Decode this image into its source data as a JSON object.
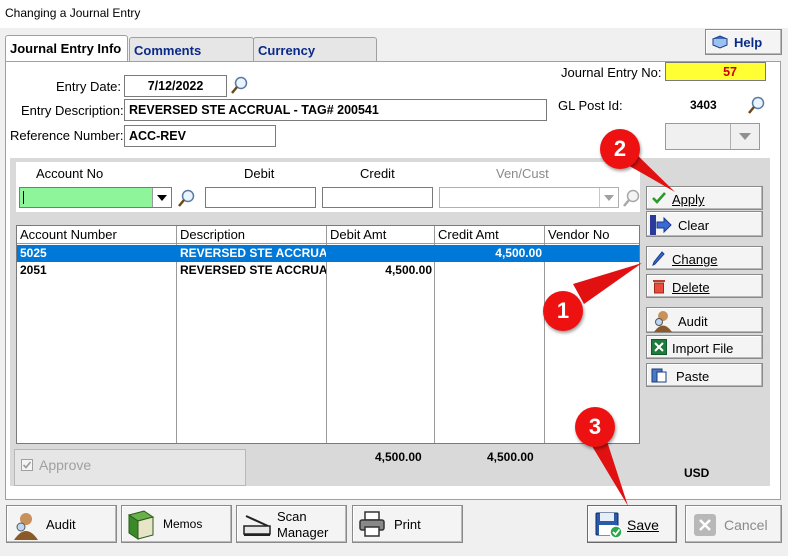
{
  "window": {
    "title": "Changing a Journal Entry"
  },
  "tabs": [
    {
      "label": "Journal Entry Info",
      "active": true
    },
    {
      "label": "Comments",
      "active": false
    },
    {
      "label": "Currency",
      "active": false
    }
  ],
  "help_label": "Help",
  "form": {
    "entry_date_label": "Entry Date:",
    "entry_date": "7/12/2022",
    "entry_description_label": "Entry Description:",
    "entry_description": "REVERSED STE ACCRUAL - TAG# 200541",
    "reference_number_label": "Reference Number:",
    "reference_number": "ACC-REV",
    "journal_entry_no_label": "Journal Entry No:",
    "journal_entry_no": "57",
    "gl_post_id_label": "GL Post Id:",
    "gl_post_id": "3403"
  },
  "entry_line": {
    "account_no_label": "Account No",
    "debit_label": "Debit",
    "credit_label": "Credit",
    "ven_cust_label": "Ven/Cust"
  },
  "grid": {
    "columns": [
      "Account Number",
      "Description",
      "Debit Amt",
      "Credit Amt",
      "Vendor No"
    ],
    "rows": [
      {
        "account": "5025",
        "description": "REVERSED STE ACCRUAL",
        "debit": "",
        "credit": "4,500.00",
        "vendor": ""
      },
      {
        "account": "2051",
        "description": "REVERSED STE ACCRUAL",
        "debit": "4,500.00",
        "credit": "",
        "vendor": ""
      }
    ]
  },
  "totals": {
    "debit": "4,500.00",
    "credit": "4,500.00",
    "currency": "USD"
  },
  "approve_label": "Approve",
  "side_buttons": {
    "apply": "Apply",
    "clear": "Clear",
    "change": "Change",
    "delete": "Delete",
    "audit": "Audit",
    "import_file": "Import File",
    "paste": "Paste"
  },
  "bottom_buttons": {
    "audit": "Audit",
    "memos": "Memos",
    "scan_manager_line1": "Scan",
    "scan_manager_line2": "Manager",
    "print": "Print",
    "save": "Save",
    "cancel": "Cancel"
  },
  "callouts": [
    "1",
    "2",
    "3"
  ],
  "colors": {
    "journal_no_bg": "#ffff33",
    "journal_no_fg": "#cc0000",
    "account_input_bg": "#8ef59a",
    "selection": "#0078d7",
    "badge": "#e11111"
  }
}
